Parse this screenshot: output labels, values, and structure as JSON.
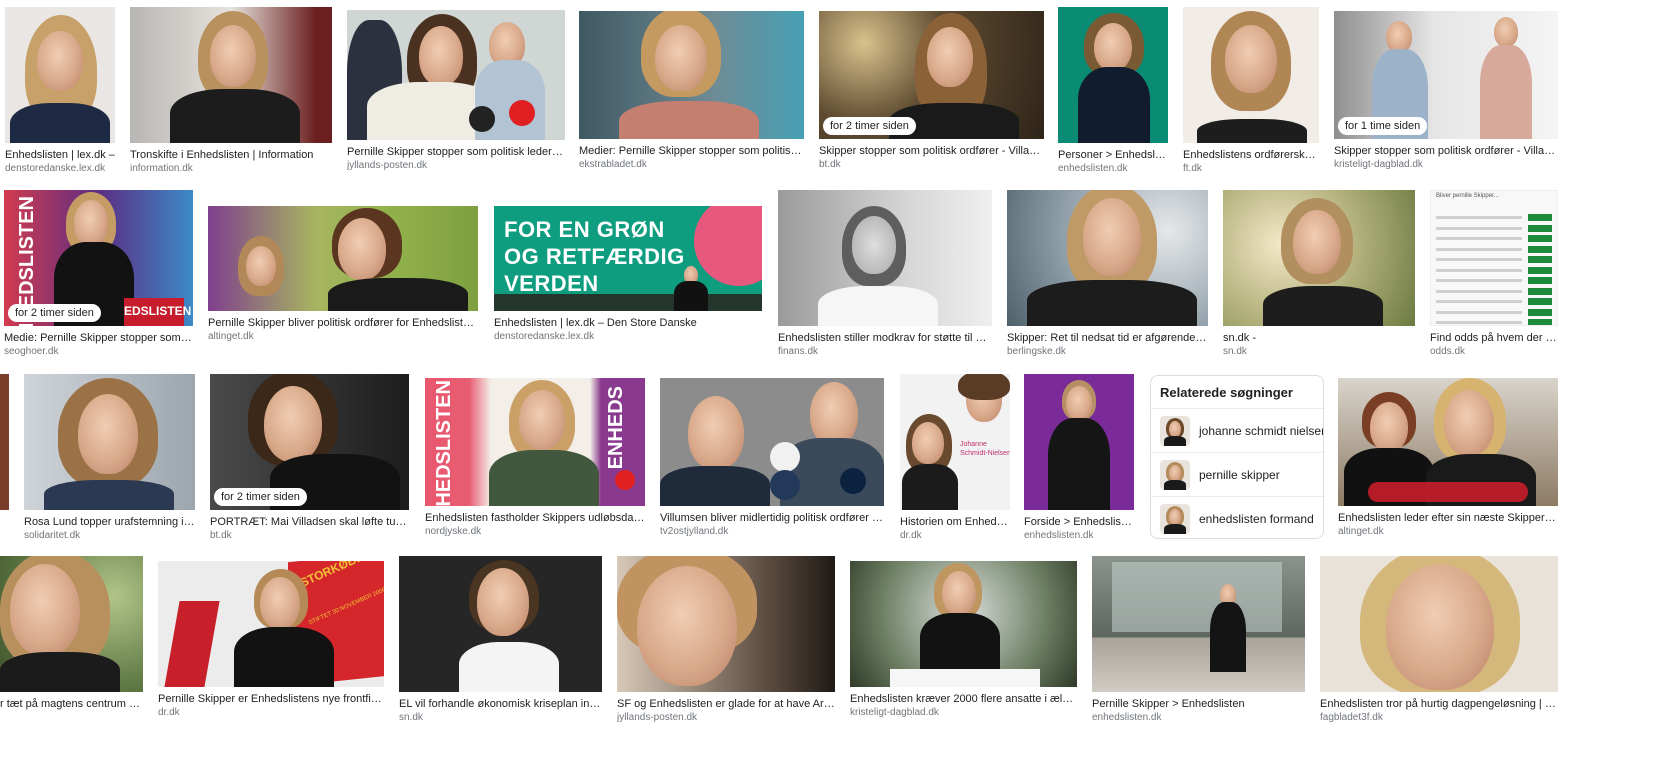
{
  "results": [
    {
      "title": "Enhedslisten | lex.dk –",
      "source": "denstoredanske.lex.dk",
      "badge": ""
    },
    {
      "title": "Tronskifte i Enhedslisten | Information",
      "source": "information.dk",
      "badge": ""
    },
    {
      "title": "Pernille Skipper stopper som politisk leder af Enh...",
      "source": "jyllands-posten.dk",
      "badge": ""
    },
    {
      "title": "Medier: Pernille Skipper stopper som politisk ordfø...",
      "source": "ekstrabladet.dk",
      "badge": ""
    },
    {
      "title": "Skipper stopper som politisk ordfører - Villadsen n...",
      "source": "bt.dk",
      "badge": "for 2 timer siden"
    },
    {
      "title": "Personer > Enhedslisten",
      "source": "enhedslisten.dk",
      "badge": ""
    },
    {
      "title": "Enhedslistens ordførerskaber...",
      "source": "ft.dk",
      "badge": ""
    },
    {
      "title": "Skipper stopper som politisk ordfører - Villadsen n...",
      "source": "kristeligt-dagblad.dk",
      "badge": "for 1 time siden"
    },
    {
      "title": "Medie: Pernille Skipper stopper som politi...",
      "source": "seoghoer.dk",
      "badge": "for 2 timer siden"
    },
    {
      "title": "Pernille Skipper bliver politisk ordfører for Enhedslisten - Altin...",
      "source": "altinget.dk",
      "badge": ""
    },
    {
      "title": "Enhedslisten | lex.dk – Den Store Danske",
      "source": "denstoredanske.lex.dk",
      "badge": ""
    },
    {
      "title": "Enhedslisten stiller modkrav for støtte til ny tidli...",
      "source": "finans.dk",
      "badge": ""
    },
    {
      "title": "Skipper: Ret til nedsat tid er afgørende brik i ...",
      "source": "berlingske.dk",
      "badge": ""
    },
    {
      "title": "sn.dk -",
      "source": "sn.dk",
      "badge": ""
    },
    {
      "title": "Find odds på hvem der skal...",
      "source": "odds.dk",
      "badge": ""
    },
    {
      "title": "Rosa Lund topper urafstemning i Enh...",
      "source": "solidaritet.dk",
      "badge": ""
    },
    {
      "title": "PORTRÆT: Mai Villadsen skal løfte tung arv i...",
      "source": "bt.dk",
      "badge": "for 2 timer siden"
    },
    {
      "title": "Enhedslisten fastholder Skippers udløbsdato | No...",
      "source": "nordjyske.dk",
      "badge": ""
    },
    {
      "title": "Villumsen bliver midlertidig politisk ordfører for En...",
      "source": "tv2ostjylland.dk",
      "badge": ""
    },
    {
      "title": "Historien om Enhedslis...",
      "source": "dr.dk",
      "badge": ""
    },
    {
      "title": "Forside > Enhedslisten",
      "source": "enhedslisten.dk",
      "badge": ""
    },
    {
      "title": "Enhedslisten leder efter sin næste Skipper - Alting...",
      "source": "altinget.dk",
      "badge": ""
    },
    {
      "title": "r tæt på magtens centrum – m...",
      "source": "",
      "badge": ""
    },
    {
      "title": "Pernille Skipper er Enhedslistens nye frontfigur | Po...",
      "source": "dr.dk",
      "badge": ""
    },
    {
      "title": "EL vil forhandle økonomisk kriseplan inden s...",
      "source": "sn.dk",
      "badge": ""
    },
    {
      "title": "SF og Enhedslisten er glade for at have Arnes ko...",
      "source": "jyllands-posten.dk",
      "badge": ""
    },
    {
      "title": "Enhedslisten kræver 2000 flere ansatte i ældrepleje...",
      "source": "kristeligt-dagblad.dk",
      "badge": ""
    },
    {
      "title": "Pernille Skipper > Enhedslisten",
      "source": "enhedslisten.dk",
      "badge": ""
    },
    {
      "title": "Enhedslisten tror på hurtig dagpengeløsning | Fagblad...",
      "source": "fagbladet3f.dk",
      "badge": ""
    }
  ],
  "posters": {
    "green_poster": "FOR EN GRØN\nOG RETFÆRDIG\nVERDEN",
    "sign_left": "ENHEDSLISTEN",
    "sign_right": "ENHEDS",
    "flag_text": "STORKØBENHAVN",
    "flag_sub": "STIFTET 30 NOVEMBER 2006",
    "johanne_card": "Johanne\nSchmidt-Nielsen",
    "sign_bottom": "EDSLISTEN",
    "red_sign": "ENHEDSLISTEN",
    "side_text": "ENHEDSLISTEN"
  },
  "related": {
    "heading": "Relaterede søgninger",
    "items": [
      {
        "label": "johanne schmidt nielsen"
      },
      {
        "label": "pernille skipper"
      },
      {
        "label": "enhedslisten formand"
      }
    ]
  },
  "odds": {
    "heading": "Bliver pernille Skipper...",
    "values": [
      "2.00",
      "2.75",
      "3.00",
      "3.50",
      "4.00",
      "5.00",
      "6.00",
      "8.00",
      "10.0",
      "12.0",
      "15.0",
      "20.0"
    ]
  },
  "colors": {
    "accent_red": "#d4262b",
    "green": "#1e8a3c",
    "teal": "#0a8c74",
    "purple": "#7b2a9a",
    "pink": "#e8577d"
  }
}
